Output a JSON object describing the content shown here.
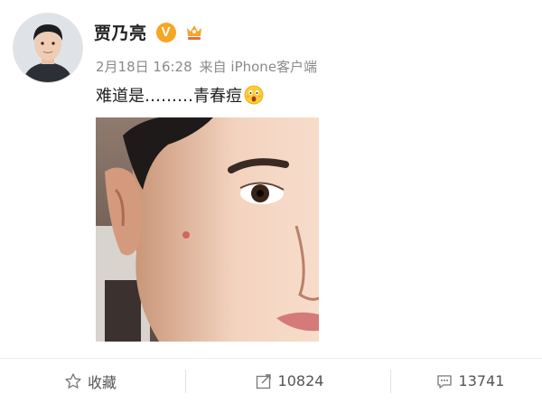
{
  "post": {
    "username": "贾乃亮",
    "verified_mark": "V",
    "date": "2月18日 16:28",
    "source": "来自 iPhone客户端",
    "text": "难道是………青春痘"
  },
  "icons": {
    "verified": "verified-badge-icon",
    "member": "vip-member-icon",
    "emoji": "shocked-emoji-icon",
    "favorite": "star-outline-icon",
    "repost": "share-arrow-icon",
    "comment": "comment-bubble-icon"
  },
  "actions": {
    "favorite_label": "收藏",
    "repost_count": "10824",
    "comment_count": "13741"
  },
  "colors": {
    "verified": "#f5a623",
    "meta_text": "#8a8a8a"
  }
}
